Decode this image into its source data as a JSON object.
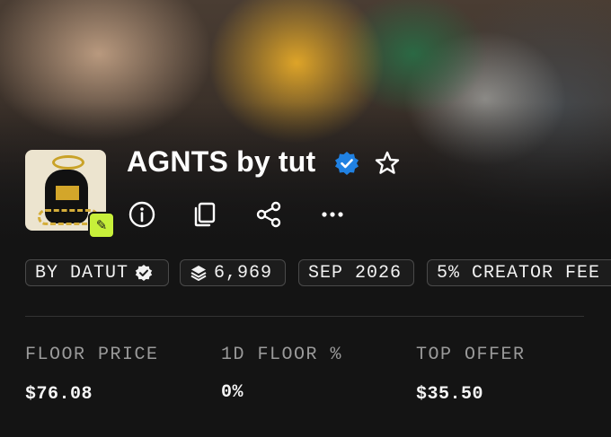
{
  "collection": {
    "name": "AGNTS by tut",
    "verified": true,
    "accent_verified": "#2081e2",
    "edit_badge_color": "#c7f03a"
  },
  "actions": {
    "icons": [
      "info-icon",
      "copy-icon",
      "share-icon",
      "more-icon"
    ]
  },
  "chips": {
    "creator": "BY DATUT",
    "items_count": "6,969",
    "date": "SEP 2026",
    "creator_fee": "5% CREATOR FEE"
  },
  "stats": [
    {
      "label": "FLOOR PRICE",
      "value": "$76.08"
    },
    {
      "label": "1D FLOOR %",
      "value": "0%"
    },
    {
      "label": "TOP OFFER",
      "value": "$35.50"
    }
  ]
}
